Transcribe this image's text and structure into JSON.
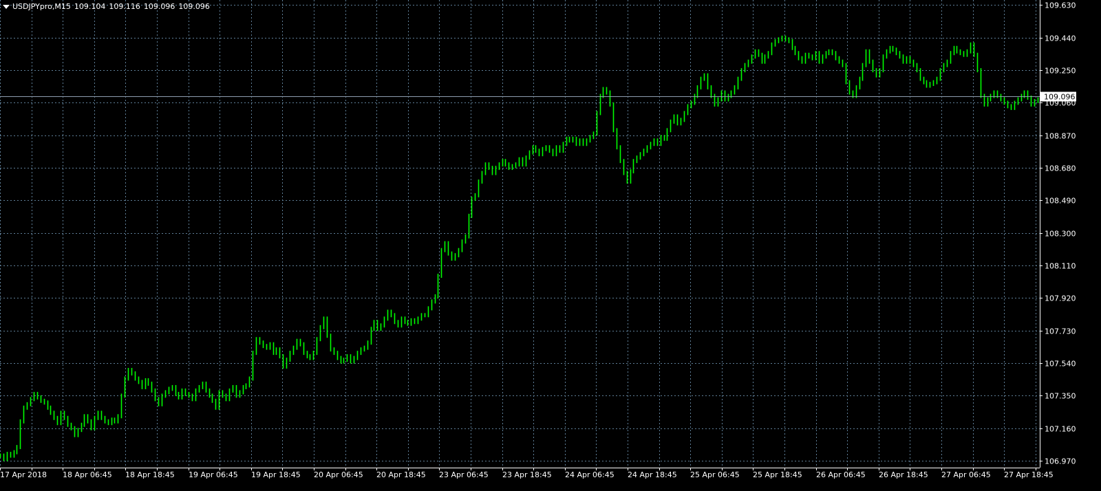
{
  "header": {
    "symbol": "USDJPYpro,M15",
    "open": "109.104",
    "high": "109.116",
    "low": "109.096",
    "close": "109.096"
  },
  "colors": {
    "background": "#000000",
    "bars": "#00ff00",
    "grid": "#5f7f98",
    "axis_text": "#ffffff",
    "bid_line": "#8f9fb0"
  },
  "chart_data": {
    "type": "line",
    "title": "USDJPYpro,M15",
    "grid": true,
    "price_axis_position": "right",
    "ylim": [
      106.93,
      109.66
    ],
    "y_ticks": [
      "109.630",
      "109.440",
      "109.250",
      "109.060",
      "108.870",
      "108.680",
      "108.490",
      "108.300",
      "108.110",
      "107.920",
      "107.730",
      "107.540",
      "107.350",
      "107.160",
      "106.970"
    ],
    "x_labels": [
      "17 Apr 2018",
      "18 Apr 06:45",
      "18 Apr 18:45",
      "19 Apr 06:45",
      "19 Apr 18:45",
      "20 Apr 06:45",
      "20 Apr 18:45",
      "23 Apr 06:45",
      "23 Apr 18:45",
      "24 Apr 06:45",
      "24 Apr 18:45",
      "25 Apr 06:45",
      "25 Apr 18:45",
      "26 Apr 06:45",
      "26 Apr 18:45",
      "27 Apr 06:45",
      "27 Apr 18:45"
    ],
    "current_price": "109.096",
    "series": [
      {
        "values": [
          107.0,
          106.98,
          107.01,
          107.0,
          107.02,
          107.05,
          107.2,
          107.28,
          107.3,
          107.33,
          107.36,
          107.34,
          107.32,
          107.31,
          107.28,
          107.25,
          107.22,
          107.19,
          107.25,
          107.22,
          107.18,
          107.16,
          107.12,
          107.15,
          107.18,
          107.23,
          107.2,
          107.16,
          107.22,
          107.25,
          107.22,
          107.2,
          107.19,
          107.21,
          107.2,
          107.23,
          107.35,
          107.45,
          107.5,
          107.48,
          107.45,
          107.43,
          107.4,
          107.44,
          107.42,
          107.38,
          107.33,
          107.3,
          107.35,
          107.37,
          107.39,
          107.4,
          107.36,
          107.34,
          107.38,
          107.36,
          107.35,
          107.33,
          107.38,
          107.4,
          107.42,
          107.38,
          107.35,
          107.32,
          107.28,
          107.37,
          107.35,
          107.33,
          107.38,
          107.4,
          107.35,
          107.37,
          107.4,
          107.41,
          107.45,
          107.6,
          107.68,
          107.66,
          107.64,
          107.63,
          107.65,
          107.6,
          107.62,
          107.58,
          107.52,
          107.56,
          107.6,
          107.63,
          107.67,
          107.65,
          107.6,
          107.58,
          107.57,
          107.6,
          107.68,
          107.75,
          107.8,
          107.7,
          107.62,
          107.6,
          107.57,
          107.55,
          107.56,
          107.58,
          107.55,
          107.57,
          107.6,
          107.62,
          107.63,
          107.66,
          107.74,
          107.78,
          107.74,
          107.76,
          107.8,
          107.84,
          107.82,
          107.78,
          107.76,
          107.8,
          107.78,
          107.77,
          107.79,
          107.78,
          107.8,
          107.82,
          107.82,
          107.86,
          107.9,
          107.93,
          108.05,
          108.2,
          108.24,
          108.18,
          108.15,
          108.17,
          108.2,
          108.25,
          108.28,
          108.4,
          108.5,
          108.52,
          108.6,
          108.65,
          108.7,
          108.68,
          108.65,
          108.68,
          108.7,
          108.72,
          108.7,
          108.68,
          108.69,
          108.7,
          108.73,
          108.7,
          108.74,
          108.77,
          108.8,
          108.78,
          108.76,
          108.79,
          108.8,
          108.78,
          108.76,
          108.8,
          108.78,
          108.82,
          108.85,
          108.84,
          108.85,
          108.82,
          108.84,
          108.82,
          108.84,
          108.86,
          108.88,
          109.0,
          109.1,
          109.14,
          109.12,
          109.05,
          108.9,
          108.8,
          108.72,
          108.65,
          108.6,
          108.66,
          108.72,
          108.74,
          108.76,
          108.78,
          108.8,
          108.82,
          108.84,
          108.82,
          108.86,
          108.85,
          108.9,
          108.95,
          108.98,
          108.94,
          108.96,
          109.0,
          109.04,
          109.06,
          109.1,
          109.15,
          109.2,
          109.22,
          109.15,
          109.1,
          109.05,
          109.08,
          109.12,
          109.08,
          109.1,
          109.12,
          109.15,
          109.2,
          109.25,
          109.28,
          109.3,
          109.33,
          109.36,
          109.34,
          109.3,
          109.33,
          109.35,
          109.4,
          109.42,
          109.43,
          109.44,
          109.43,
          109.42,
          109.38,
          109.35,
          109.32,
          109.3,
          109.34,
          109.33,
          109.32,
          109.35,
          109.3,
          109.33,
          109.35,
          109.36,
          109.35,
          109.32,
          109.3,
          109.28,
          109.18,
          109.12,
          109.1,
          109.15,
          109.2,
          109.28,
          109.36,
          109.3,
          109.25,
          109.22,
          109.25,
          109.33,
          109.36,
          109.38,
          109.37,
          109.35,
          109.33,
          109.3,
          109.32,
          109.3,
          109.28,
          109.25,
          109.2,
          109.18,
          109.16,
          109.17,
          109.18,
          109.2,
          109.25,
          109.28,
          109.3,
          109.35,
          109.38,
          109.36,
          109.35,
          109.34,
          109.36,
          109.4,
          109.34,
          109.25,
          109.1,
          109.05,
          109.08,
          109.1,
          109.12,
          109.1,
          109.08,
          109.06,
          109.04,
          109.03,
          109.06,
          109.08,
          109.1,
          109.12,
          109.09,
          109.05,
          109.07,
          109.08
        ]
      }
    ]
  }
}
